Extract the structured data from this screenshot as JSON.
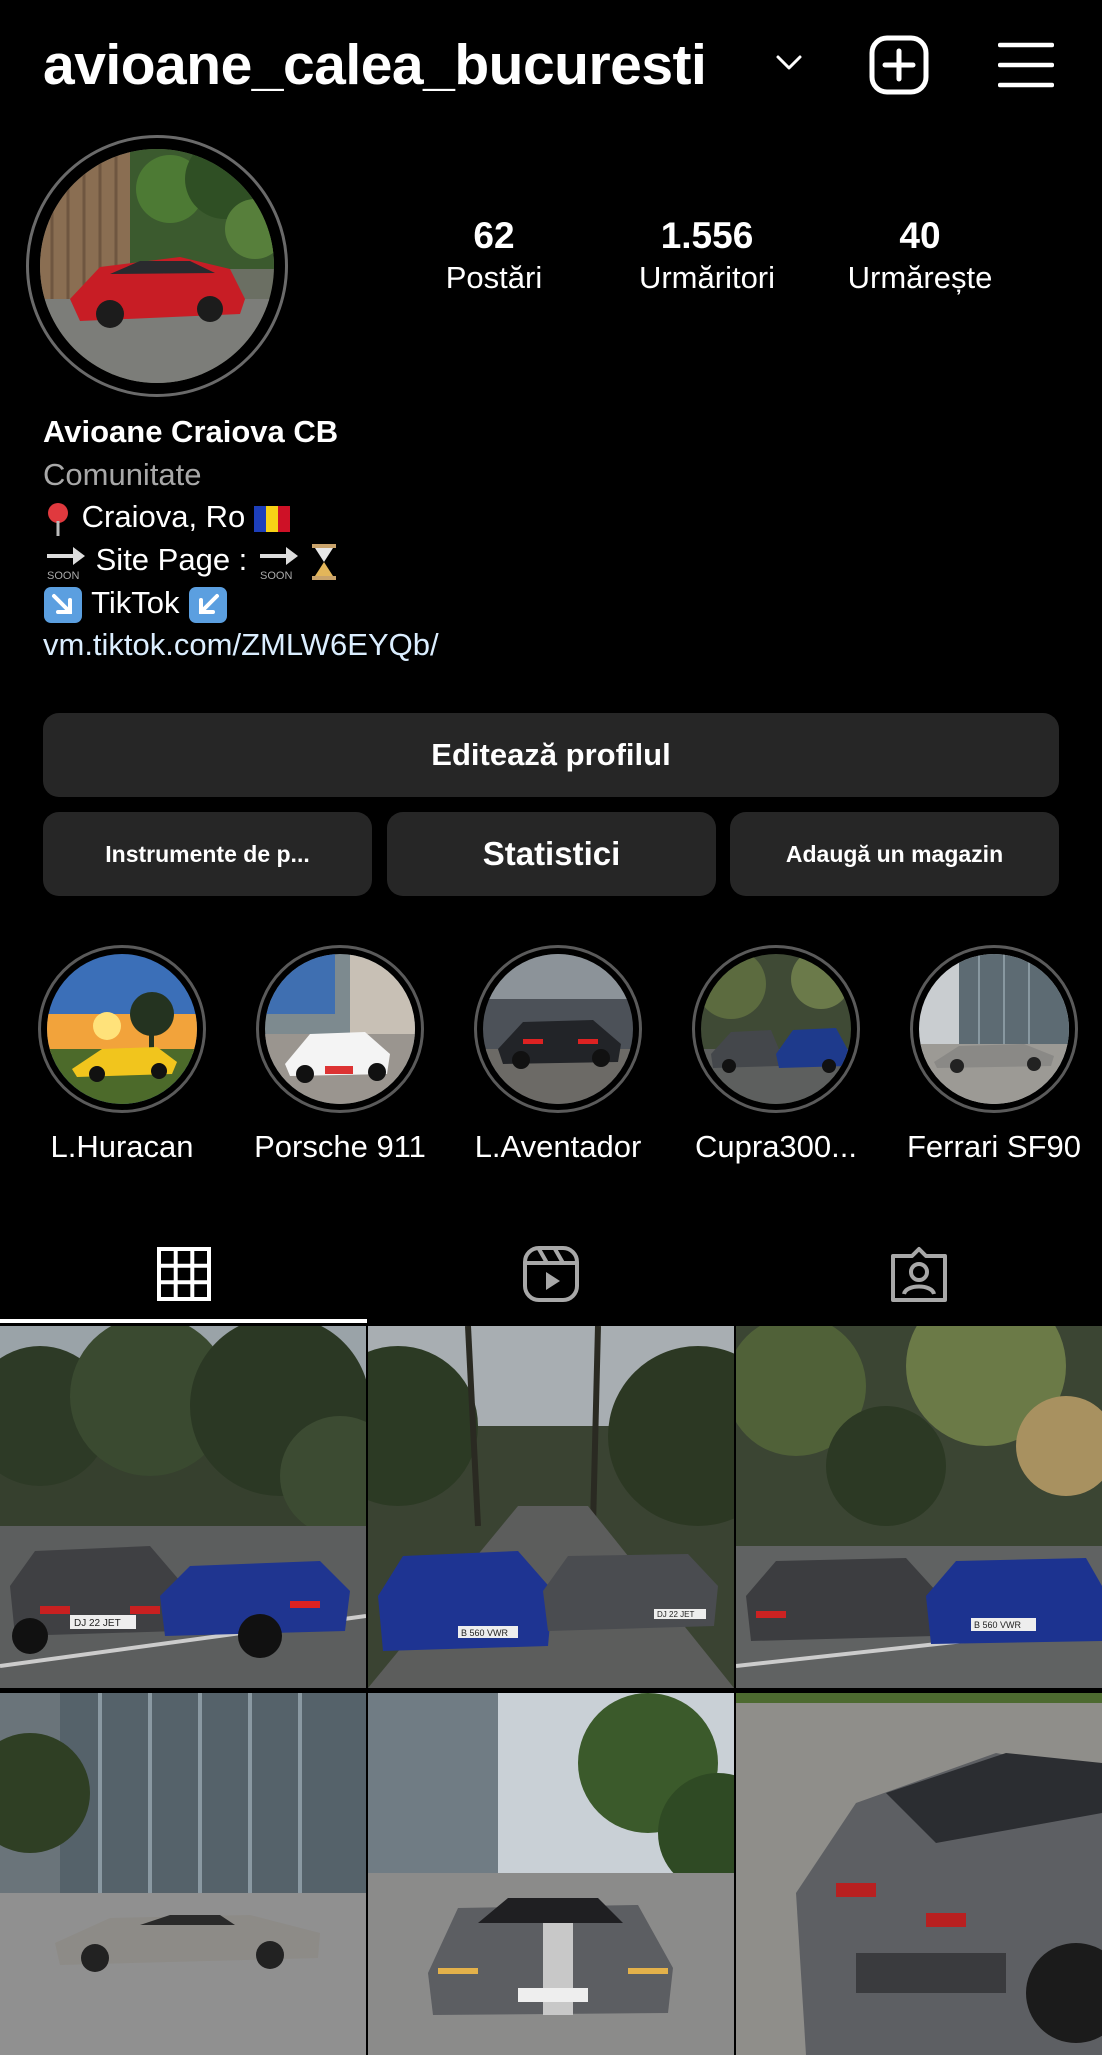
{
  "header": {
    "username": "avioane_calea_bucuresti"
  },
  "profile": {
    "stats": [
      {
        "value": "62",
        "label": "Postări"
      },
      {
        "value": "1.556",
        "label": "Urmăritori"
      },
      {
        "value": "40",
        "label": "Urmărește"
      }
    ],
    "display_name": "Avioane Craiova CB",
    "category": "Comunitate",
    "bio_line_1": "Craiova, Ro",
    "bio_line_2": "Site Page :",
    "bio_line_3": "TikTok",
    "link": "vm.tiktok.com/ZMLW6EYQb/",
    "soon_label": "SOON"
  },
  "actions": {
    "edit_profile": "Editează profilul",
    "tools": "Instrumente de p...",
    "stats": "Statistici",
    "shop": "Adaugă un magazin"
  },
  "highlights": [
    {
      "label": "L.Huracan"
    },
    {
      "label": "Porsche 911"
    },
    {
      "label": "L.Aventador"
    },
    {
      "label": "Cupra300..."
    },
    {
      "label": "Ferrari SF90"
    }
  ],
  "tabs": [
    "posts-grid-icon",
    "reels-icon",
    "tagged-icon"
  ],
  "plates": [
    "DJ 22 JET",
    "B 560 VWR",
    "DJ 22 JET",
    "B 560 VWR"
  ],
  "colors": {
    "background": "#000000",
    "button": "#262626",
    "muted": "#a8a8a8",
    "link": "#e0ecff"
  }
}
